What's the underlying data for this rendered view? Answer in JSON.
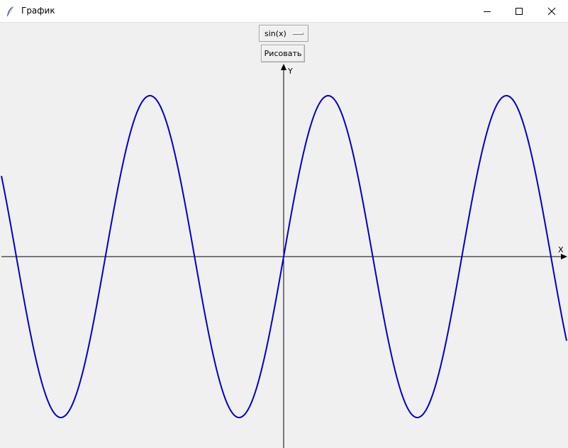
{
  "window": {
    "title": "График"
  },
  "controls": {
    "function_select_value": "sin(x)",
    "draw_button_label": "Рисовать"
  },
  "chart_data": {
    "type": "line",
    "function": "sin(x)",
    "xlabel": "X",
    "ylabel": "Y",
    "x_range": [
      -10,
      10
    ],
    "y_range": [
      -1.5,
      1.5
    ],
    "series": [
      {
        "expression": "sin(x)",
        "color": "#0000cc"
      }
    ],
    "grid": false
  }
}
